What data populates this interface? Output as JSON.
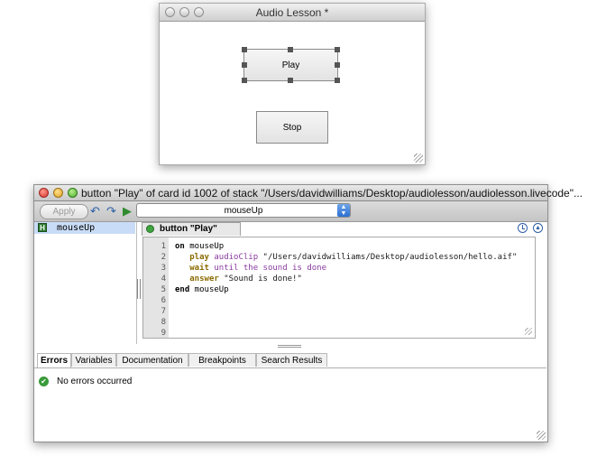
{
  "stack_window": {
    "title": "Audio Lesson *",
    "play_button_label": "Play",
    "stop_button_label": "Stop"
  },
  "editor_window": {
    "title": "button \"Play\" of card id 1002 of stack \"/Users/davidwilliams/Desktop/audiolesson/audiolesson.livecode\"...",
    "toolbar": {
      "apply_label": "Apply",
      "undo_icon": "↶",
      "redo_icon": "↷",
      "run_icon": "▶",
      "handler_selected": "mouseUp"
    },
    "handler_list": [
      {
        "badge": "H",
        "name": "mouseUp"
      }
    ],
    "script_tab": {
      "label": "button \"Play\""
    },
    "line_numbers": [
      "1",
      "2",
      "3",
      "4",
      "5",
      "6",
      "7",
      "8",
      "9"
    ],
    "code": {
      "l1_kw": "on",
      "l1_name": " mouseUp",
      "l2_indent": "   ",
      "l2_cmd": "play",
      "l2_prop": " audioClip",
      "l2_str": " \"/Users/davidwilliams/Desktop/audiolesson/hello.aif\"",
      "l3_indent": "   ",
      "l3_cmd": "wait",
      "l3_rest": " until the sound is done",
      "l4_indent": "   ",
      "l4_cmd": "answer",
      "l4_str": " \"Sound is done!\"",
      "l5_kw": "end",
      "l5_name": " mouseUp"
    },
    "bottom_tabs": [
      "Errors",
      "Variables",
      "Documentation",
      "Breakpoints",
      "Search Results"
    ],
    "status_message": "No errors occurred",
    "colors": {
      "selection": "#c9dcf7",
      "accent": "#2d6fd0",
      "ok_green": "#3a9b3a"
    }
  }
}
